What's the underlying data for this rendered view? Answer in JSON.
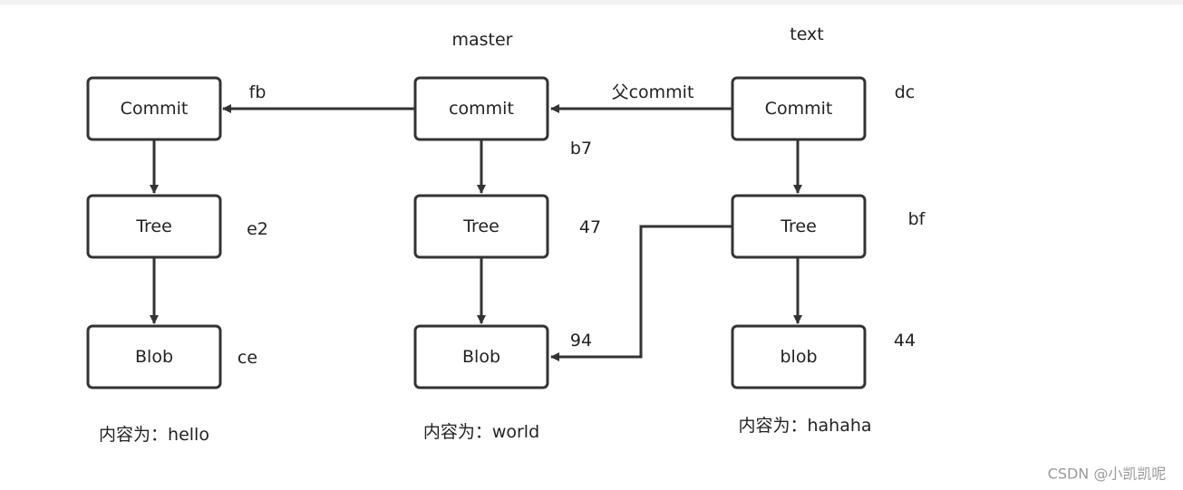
{
  "nodes": {
    "c1": "Commit",
    "t1": "Tree",
    "b1": "Blob",
    "c2": "commit",
    "t2": "Tree",
    "b2": "Blob",
    "c3": "Commit",
    "t3": "Tree",
    "b3": "blob"
  },
  "labels": {
    "master": "master",
    "text": "text",
    "fb": "fb",
    "parent_commit": "父commit",
    "dc": "dc",
    "b7": "b7",
    "e2": "e2",
    "h47": "47",
    "bf": "bf",
    "ce": "ce",
    "h94": "94",
    "h44": "44",
    "content1": "内容为：hello",
    "content2": "内容为：world",
    "content3": "内容为：hahaha"
  },
  "watermark": "CSDN @小凯凯呢"
}
